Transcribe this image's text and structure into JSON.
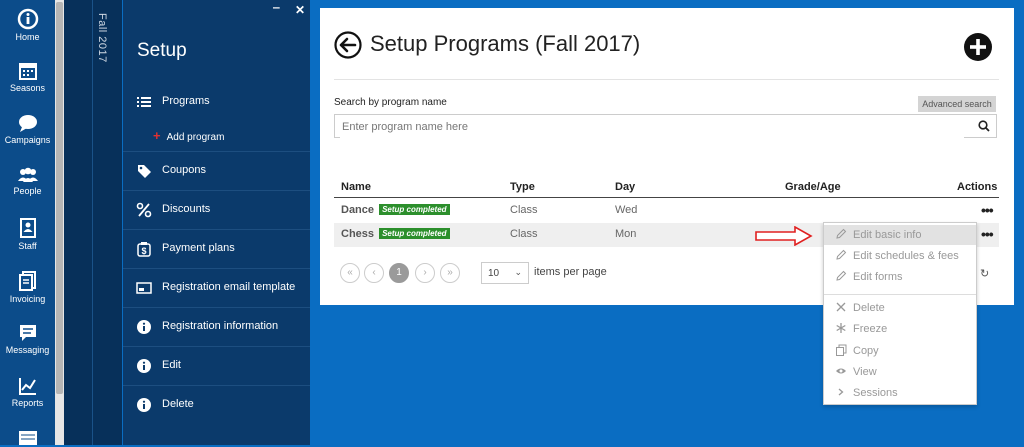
{
  "rail": {
    "items": [
      {
        "label": "Home",
        "icon": "home-icon"
      },
      {
        "label": "Seasons",
        "icon": "calendar-icon"
      },
      {
        "label": "Campaigns",
        "icon": "chat-icon"
      },
      {
        "label": "People",
        "icon": "people-icon"
      },
      {
        "label": "Staff",
        "icon": "staff-icon"
      },
      {
        "label": "Invoicing",
        "icon": "invoice-icon"
      },
      {
        "label": "Messaging",
        "icon": "message-icon"
      },
      {
        "label": "Reports",
        "icon": "chart-icon"
      }
    ]
  },
  "season": {
    "label": "Fall 2017"
  },
  "panel": {
    "title": "Setup",
    "minimize": "‒",
    "close": "✕",
    "items": [
      {
        "label": "Programs",
        "icon": "list-icon"
      },
      {
        "label": "Coupons",
        "icon": "tag-icon"
      },
      {
        "label": "Discounts",
        "icon": "percent-icon"
      },
      {
        "label": "Payment plans",
        "icon": "dollar-icon"
      },
      {
        "label": "Registration email template",
        "icon": "email-icon"
      },
      {
        "label": "Registration information",
        "icon": "info-icon"
      },
      {
        "label": "Edit",
        "icon": "info-icon"
      },
      {
        "label": "Delete",
        "icon": "info-icon"
      }
    ],
    "sub_item": "Add program"
  },
  "main": {
    "title": "Setup Programs (Fall 2017)",
    "search_label": "Search by program name",
    "advanced_search": "Advanced search",
    "search_placeholder": "Enter program name here",
    "columns": [
      "Name",
      "Type",
      "Day",
      "Grade/Age",
      "Actions"
    ],
    "rows": [
      {
        "name": "Dance",
        "badge": "Setup completed",
        "type": "Class",
        "day": "Wed",
        "actions": "•••"
      },
      {
        "name": "Chess",
        "badge": "Setup completed",
        "type": "Class",
        "day": "Mon",
        "actions": "•••"
      }
    ],
    "pagination": {
      "first": "«",
      "prev": "‹",
      "current": "1",
      "next": "›",
      "last": "»",
      "per_page": "10",
      "per_page_label": "items per page",
      "refresh": "↻"
    }
  },
  "menu": {
    "items": [
      {
        "label": "Edit basic info",
        "icon": "pencil-icon"
      },
      {
        "label": "Edit schedules & fees",
        "icon": "pencil-icon"
      },
      {
        "label": "Edit forms",
        "icon": "pencil-icon"
      },
      {
        "label": "Delete",
        "icon": "x-icon"
      },
      {
        "label": "Freeze",
        "icon": "snowflake-icon"
      },
      {
        "label": "Copy",
        "icon": "copy-icon"
      },
      {
        "label": "View",
        "icon": "eye-icon"
      },
      {
        "label": "Sessions",
        "icon": "chevron-right-icon"
      }
    ]
  },
  "colors": {
    "rail": "#0c4c8a",
    "panel": "#0b3a6b",
    "background": "#0a6dc2",
    "badge": "#2c8f2c",
    "arrow": "#e02020"
  }
}
